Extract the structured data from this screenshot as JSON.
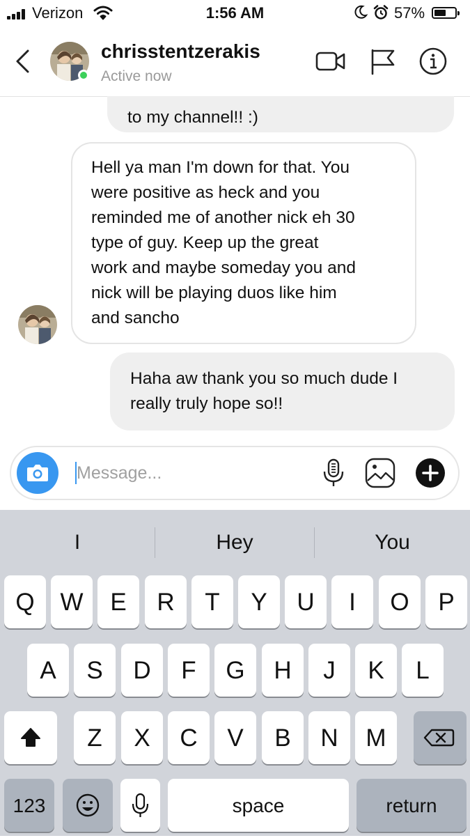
{
  "status_bar": {
    "carrier": "Verizon",
    "time": "1:56 AM",
    "battery_percent": "57%",
    "battery_level": 0.57,
    "icons": [
      "signal-bars-icon",
      "wifi-icon",
      "moon-icon",
      "alarm-icon",
      "battery-icon"
    ]
  },
  "header": {
    "username": "chrisstentzerakis",
    "status": "Active now",
    "icons": [
      "back-chevron-icon",
      "video-call-icon",
      "flag-icon",
      "info-icon"
    ]
  },
  "messages": [
    {
      "direction": "sent",
      "text": "to my channel!! :)"
    },
    {
      "direction": "received",
      "lines": [
        "Hell ya man I'm down for that. You",
        "were positive as heck and you",
        "reminded me of another nick eh 30",
        "type of guy. Keep up the great",
        "work and maybe someday you and",
        "nick will be playing duos like him",
        "and sancho"
      ]
    },
    {
      "direction": "sent",
      "lines": [
        "Haha aw thank you so much dude I",
        "really truly hope so!!"
      ]
    }
  ],
  "composer": {
    "placeholder": "Message...",
    "value": "",
    "icons": [
      "camera-icon",
      "microphone-icon",
      "gallery-icon",
      "add-icon"
    ]
  },
  "keyboard": {
    "suggestions": [
      "I",
      "Hey",
      "You"
    ],
    "row1": [
      "Q",
      "W",
      "E",
      "R",
      "T",
      "Y",
      "U",
      "I",
      "O",
      "P"
    ],
    "row2": [
      "A",
      "S",
      "D",
      "F",
      "G",
      "H",
      "J",
      "K",
      "L"
    ],
    "row3": [
      "Z",
      "X",
      "C",
      "V",
      "B",
      "N",
      "M"
    ],
    "numbers_label": "123",
    "space_label": "space",
    "return_label": "return",
    "icons": [
      "shift-icon",
      "backspace-icon",
      "emoji-icon",
      "dictation-mic-icon"
    ]
  },
  "colors": {
    "accent": "#3897f0",
    "active_dot": "#3cd05a",
    "sent_bubble": "#efefef",
    "keyboard_bg": "#d1d4da",
    "function_key": "#acb3bd"
  }
}
